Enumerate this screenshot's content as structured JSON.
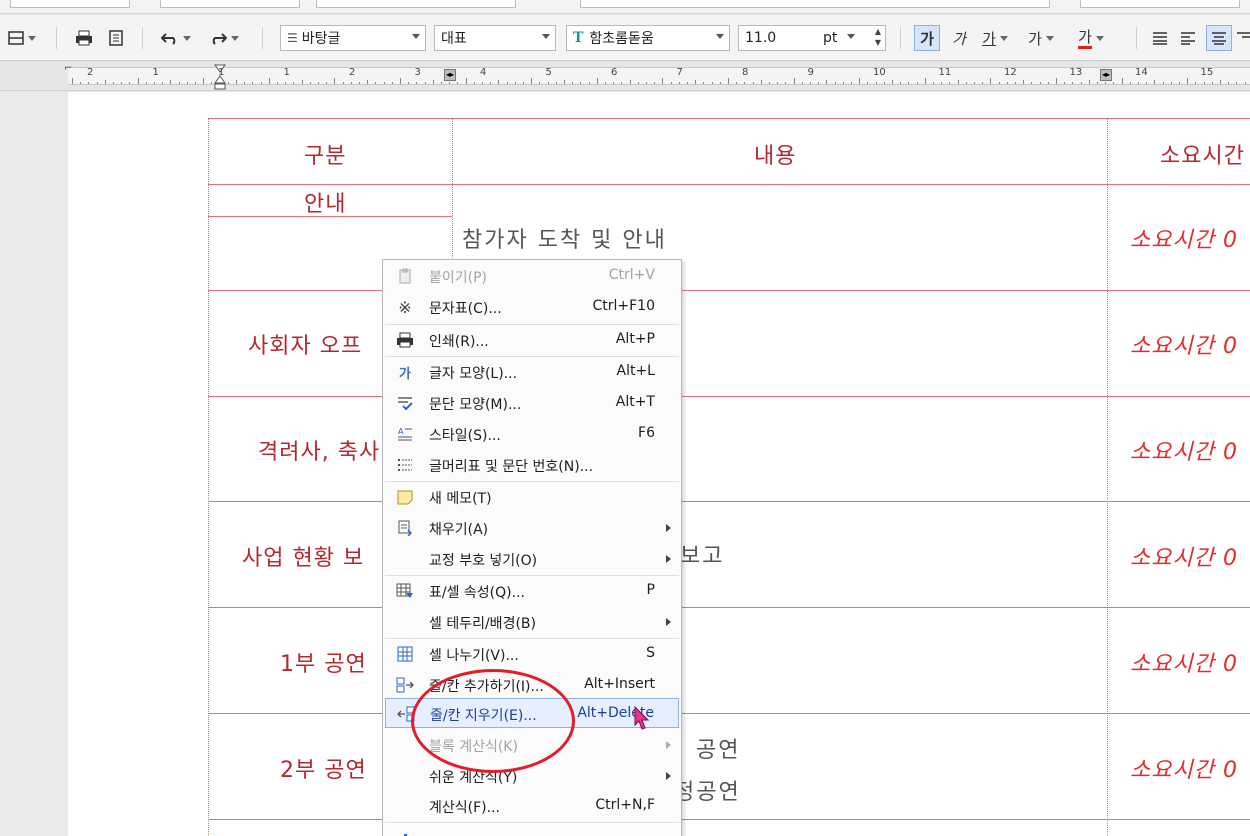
{
  "toolbar": {
    "style_combo": "바탕글",
    "lang_combo": "대표",
    "font_combo": "함초롬돋움",
    "font_size": "11.0",
    "font_unit": "pt",
    "bold_glyph": "가",
    "italic_glyph": "가",
    "underline_glyph": "가",
    "strike_glyph": "가",
    "color_glyph": "가"
  },
  "ruler": {
    "numbers": [
      "2",
      "1",
      "1",
      "1",
      "2",
      "3",
      "4",
      "5",
      "6",
      "7",
      "8",
      "9",
      "10",
      "11",
      "12",
      "13",
      "14",
      "15"
    ]
  },
  "table": {
    "header": {
      "col1": "구분",
      "col2": "내용",
      "col3": "소요시간"
    },
    "rows": [
      {
        "label": "안내",
        "content": "참가자 도착 및 안내",
        "time": "소요시간 0"
      },
      {
        "label": "사회자 오프",
        "content": "",
        "time": "소요시간 0"
      },
      {
        "label": "격려사, 축사",
        "content": "",
        "time": "소요시간 0"
      },
      {
        "label": "사업 현황 보",
        "content": "보고",
        "time": "소요시간 0"
      },
      {
        "label": "1부 공연",
        "content": "",
        "time": "소요시간 0"
      },
      {
        "label": "2부 공연",
        "content": "공연",
        "content2": "정공연",
        "time": "소요시간 0"
      }
    ]
  },
  "context_menu": {
    "items": [
      {
        "label": "붙이기(P)",
        "shortcut": "Ctrl+V",
        "icon": "paste-icon",
        "disabled": true
      },
      {
        "label": "문자표(C)...",
        "shortcut": "Ctrl+F10",
        "icon": "symbol-icon"
      },
      {
        "label": "인쇄(R)...",
        "shortcut": "Alt+P",
        "icon": "printer-icon"
      },
      {
        "label": "글자 모양(L)...",
        "shortcut": "Alt+L",
        "icon": "char-shape-icon"
      },
      {
        "label": "문단 모양(M)...",
        "shortcut": "Alt+T",
        "icon": "para-shape-icon"
      },
      {
        "label": "스타일(S)...",
        "shortcut": "F6",
        "icon": "style-icon"
      },
      {
        "label": "글머리표 및 문단 번호(N)...",
        "shortcut": "",
        "icon": "bullet-icon"
      },
      {
        "label": "새 메모(T)",
        "shortcut": "",
        "icon": "memo-icon"
      },
      {
        "label": "채우기(A)",
        "shortcut": "",
        "icon": "fill-icon",
        "submenu": true
      },
      {
        "label": "교정 부호 넣기(O)",
        "shortcut": "",
        "icon": "",
        "submenu": true
      },
      {
        "label": "표/셀 속성(Q)...",
        "shortcut": "P",
        "icon": "table-props-icon"
      },
      {
        "label": "셀 테두리/배경(B)",
        "shortcut": "",
        "icon": "",
        "submenu": true
      },
      {
        "label": "셀 나누기(V)...",
        "shortcut": "S",
        "icon": "split-cell-icon"
      },
      {
        "label": "줄/칸 추가하기(I)...",
        "shortcut": "Alt+Insert",
        "icon": "insert-rowcol-icon"
      },
      {
        "label": "줄/칸 지우기(E)...",
        "shortcut": "Alt+Delete",
        "icon": "delete-rowcol-icon",
        "highlighted": true
      },
      {
        "label": "블록 계산식(K)",
        "shortcut": "",
        "icon": "",
        "disabled": true,
        "submenu": true
      },
      {
        "label": "쉬운 계산식(Y)",
        "shortcut": "",
        "icon": "",
        "submenu": true
      },
      {
        "label": "계산식(F)...",
        "shortcut": "Ctrl+N,F",
        "icon": ""
      }
    ]
  },
  "colors": {
    "table_line": "#e57373",
    "label_text": "#b4282f",
    "time_text": "#e22b2b",
    "highlight_ring": "#e31c2a"
  }
}
